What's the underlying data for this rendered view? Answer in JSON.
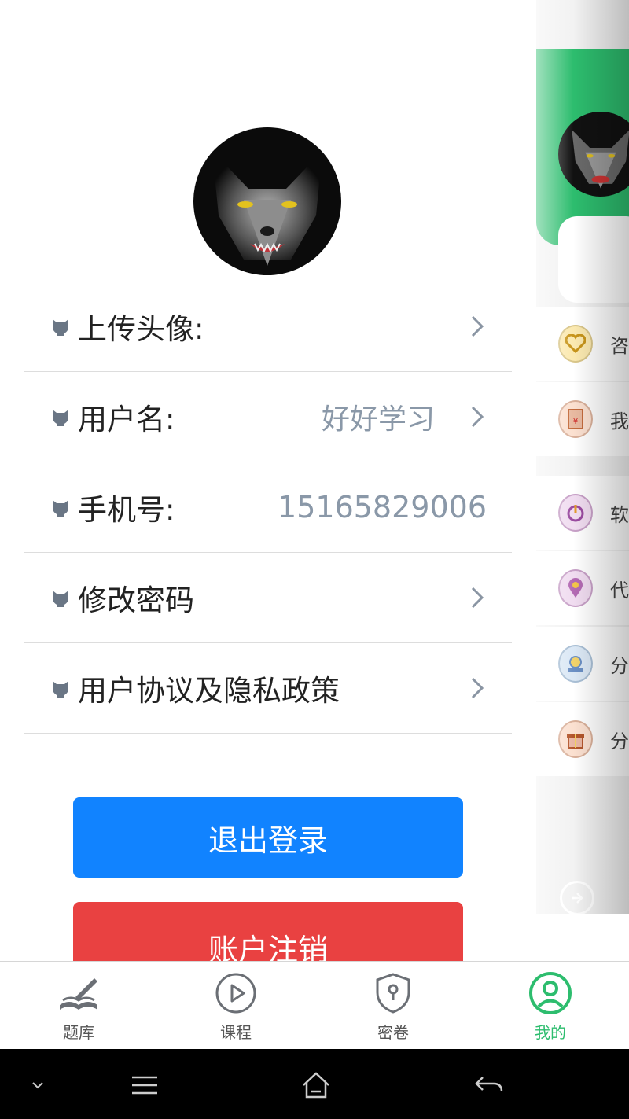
{
  "drawer": {
    "menu": [
      {
        "label": "上传头像:",
        "value": ""
      },
      {
        "label": "用户名:",
        "value": "好好学习"
      },
      {
        "label": "手机号:",
        "value": "15165829006"
      },
      {
        "label": "修改密码",
        "value": ""
      },
      {
        "label": "用户协议及隐私政策",
        "value": ""
      }
    ],
    "logout_label": "退出登录",
    "cancel_account_label": "账户注销"
  },
  "peek": {
    "items": [
      "咨",
      "我",
      "软",
      "代",
      "分",
      "分"
    ]
  },
  "tabbar": {
    "tabs": [
      {
        "label": "题库",
        "icon": "book-pen-icon"
      },
      {
        "label": "课程",
        "icon": "play-circle-icon"
      },
      {
        "label": "密卷",
        "icon": "shield-lock-icon"
      },
      {
        "label": "我的",
        "icon": "user-circle-icon",
        "active": true
      }
    ]
  },
  "colors": {
    "accent_green": "#2dbd6e",
    "logout_blue": "#1183ff",
    "cancel_red": "#e94141"
  }
}
